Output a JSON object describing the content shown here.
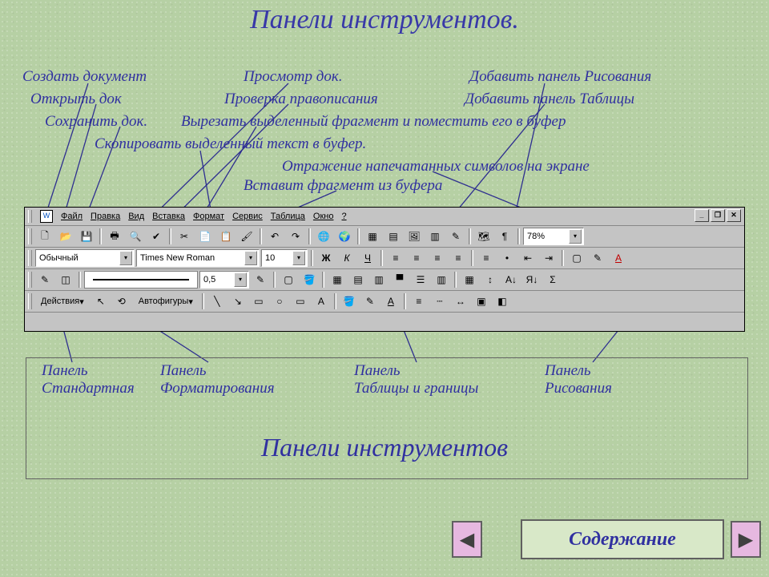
{
  "title": "Панели инструментов.",
  "annotations": {
    "create_doc": "Создать документ",
    "open_doc": "Открыть док",
    "save_doc": "Сохранить док.",
    "copy_buffer": "Скопировать выделенный текст в буфер.",
    "preview_doc": "Просмотр док.",
    "spellcheck": "Проверка правописания",
    "cut_buffer": "Вырезать выделенный фрагмент и поместить его в буфер",
    "paste_buffer": "Вставит фрагмент из буфера",
    "show_chars": "Отражение напечатанных символов на экране",
    "add_drawing": "Добавить панель Рисования",
    "add_tables": "Добавить панель Таблицы"
  },
  "panel_labels": {
    "standard": "Панель\nСтандартная",
    "formatting": "Панель\nФорматирования",
    "tables": "Панель\nТаблицы и границы",
    "drawing": "Панель\nРисования"
  },
  "subtitle": "Панели инструментов",
  "contents_btn": "Содержание",
  "menu": {
    "file": "Файл",
    "edit": "Правка",
    "view": "Вид",
    "insert": "Вставка",
    "format": "Формат",
    "tools": "Сервис",
    "table": "Таблица",
    "window": "Окно",
    "help": "?"
  },
  "toolbar": {
    "style": "Обычный",
    "font": "Times New Roman",
    "size": "10",
    "zoom": "78%",
    "line_weight": "0,5",
    "bold": "Ж",
    "italic": "К",
    "underline": "Ч",
    "actions": "Действия",
    "autoshapes": "Автофигуры",
    "paragraph": "¶"
  },
  "icons": {
    "new": "🗋",
    "open": "📂",
    "save": "💾",
    "print": "🖶",
    "preview": "🔍",
    "spell": "✔",
    "cut": "✂",
    "copy": "📄",
    "paste": "📋",
    "brush": "🖌",
    "undo": "↶",
    "redo": "↷",
    "link": "🌐",
    "web": "🌍",
    "tables": "▦",
    "excel": "▤",
    "paint": "🖼",
    "cols": "▥",
    "drawing": "✎",
    "map": "🗺",
    "showhide": "¶",
    "alignL": "≡",
    "alignC": "≡",
    "alignR": "≡",
    "alignJ": "≡",
    "numlist": "≡",
    "bullist": "•",
    "outdent": "⇤",
    "indent": "⇥",
    "borders": "▢",
    "highlight": "✎",
    "fontcolor": "A",
    "pencil": "✎",
    "eraser": "◫",
    "select": "↖",
    "rotate": "⟲",
    "textbox": "▭",
    "line": "╲",
    "arrow": "↘",
    "rect": "▭",
    "oval": "○",
    "wordart": "A",
    "fill": "🪣",
    "linecolor": "✎",
    "shadow": "▣",
    "threed": "◧",
    "sortAZ": "A↓",
    "sortZA": "Я↓",
    "sum": "Σ"
  }
}
